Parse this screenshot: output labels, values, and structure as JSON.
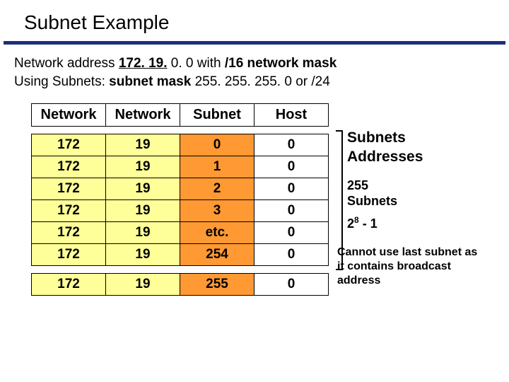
{
  "title": "Subnet Example",
  "intro_prefix": "Network address ",
  "intro_addr": "172. 19.",
  "intro_suffix1": " 0. 0 with ",
  "intro_mask1": "/16 network mask",
  "intro_line2a": "Using Subnets: ",
  "intro_line2b": "subnet mask",
  "intro_line2c": " 255. 255. 255. 0 or /24",
  "headers": {
    "net1": "Network",
    "net2": "Network",
    "subnet": "Subnet",
    "host": "Host"
  },
  "rows": [
    {
      "n1": "172",
      "n2": "19",
      "s": "0",
      "h": "0"
    },
    {
      "n1": "172",
      "n2": "19",
      "s": "1",
      "h": "0"
    },
    {
      "n1": "172",
      "n2": "19",
      "s": "2",
      "h": "0"
    },
    {
      "n1": "172",
      "n2": "19",
      "s": "3",
      "h": "0"
    },
    {
      "n1": "172",
      "n2": "19",
      "s": "etc.",
      "h": "0"
    },
    {
      "n1": "172",
      "n2": "19",
      "s": "254",
      "h": "0"
    }
  ],
  "last_row": {
    "n1": "172",
    "n2": "19",
    "s": "255",
    "h": "0"
  },
  "notes": {
    "title_l1": "Subnets",
    "title_l2": "Addresses",
    "count_l1": "255",
    "count_l2": "Subnets",
    "formula_base": "2",
    "formula_exp": "8",
    "formula_rest": " - 1",
    "last": "Cannot use last subnet as it contains broadcast address"
  }
}
